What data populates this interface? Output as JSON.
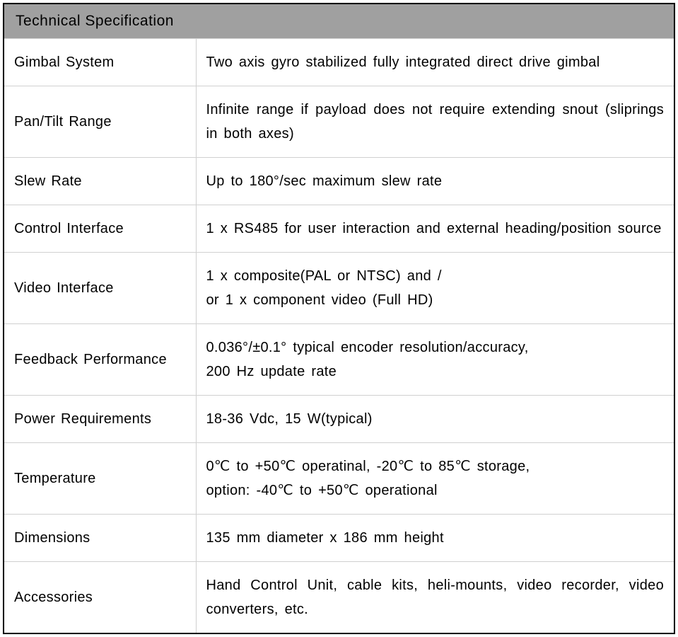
{
  "title": "Technical Specification",
  "rows": [
    {
      "label": "Gimbal System",
      "value": "Two axis gyro stabilized fully integrated direct drive gimbal"
    },
    {
      "label": "Pan/Tilt Range",
      "value": "Infinite range if payload does not require extending snout (sliprings in both axes)"
    },
    {
      "label": "Slew Rate",
      "value": "Up to 180°/sec maximum slew rate"
    },
    {
      "label": "Control Interface",
      "value": "1 x RS485 for user interaction and external heading/position source"
    },
    {
      "label": "Video Interface",
      "value": "1 x composite(PAL or NTSC) and /\nor 1 x component video (Full HD)"
    },
    {
      "label": "Feedback Performance",
      "value": "0.036°/±0.1° typical encoder resolution/accuracy,\n200 Hz update rate"
    },
    {
      "label": "Power Requirements",
      "value": "18-36 Vdc, 15 W(typical)"
    },
    {
      "label": "Temperature",
      "value": "0℃ to +50℃ operatinal, -20℃ to 85℃ storage,\noption: -40℃ to +50℃ operational"
    },
    {
      "label": "Dimensions",
      "value": "135 mm diameter x 186 mm height"
    },
    {
      "label": "Accessories",
      "value": "Hand Control Unit, cable kits, heli-mounts, video recorder, video converters, etc."
    }
  ]
}
